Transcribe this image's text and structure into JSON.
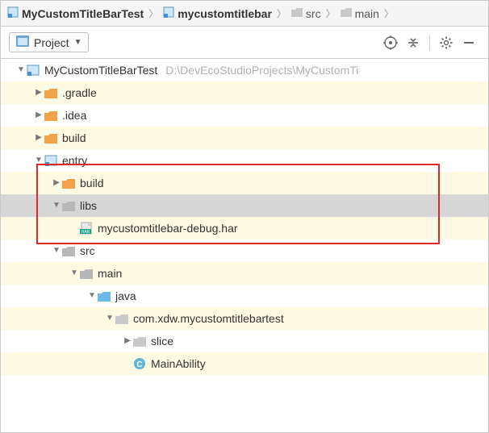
{
  "breadcrumb": [
    {
      "label": "MyCustomTitleBarTest",
      "icon": "module",
      "bold": true
    },
    {
      "label": "mycustomtitlebar",
      "icon": "module",
      "bold": true
    },
    {
      "label": "src",
      "icon": "folder-gray",
      "bold": false
    },
    {
      "label": "main",
      "icon": "folder-gray",
      "bold": false
    }
  ],
  "toolbar": {
    "view_selector": "Project"
  },
  "tree": {
    "root": {
      "label": "MyCustomTitleBarTest",
      "path": "D:\\DevEcoStudioProjects\\MyCustomTi"
    },
    "gradle": ".gradle",
    "idea": ".idea",
    "build": "build",
    "entry": "entry",
    "entry_build": "build",
    "libs": "libs",
    "har_file": "mycustomtitlebar-debug.har",
    "src": "src",
    "main": "main",
    "java": "java",
    "package": "com.xdw.mycustomtitlebartest",
    "slice": "slice",
    "main_ability": "MainAbility"
  }
}
